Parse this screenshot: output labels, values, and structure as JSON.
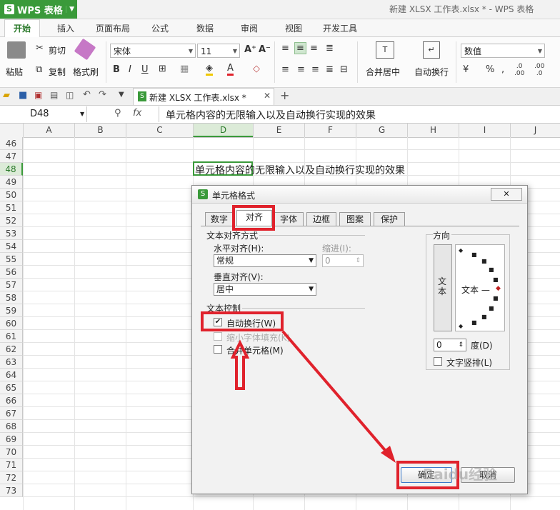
{
  "app": {
    "name": "WPS 表格",
    "window_title": "新建 XLSX 工作表.xlsx * - WPS 表格"
  },
  "menu_tabs": [
    "开始",
    "插入",
    "页面布局",
    "公式",
    "数据",
    "审阅",
    "视图",
    "开发工具"
  ],
  "ribbon": {
    "paste": "粘贴",
    "cut": "剪切",
    "copy": "复制",
    "format_painter": "格式刷",
    "font_name": "宋体",
    "font_size": "11",
    "merge_center": "合并居中",
    "wrap_text": "自动换行",
    "number_format": "数值",
    "percent": "%"
  },
  "doc_tab": {
    "label": "新建 XLSX 工作表.xlsx *"
  },
  "formula_bar": {
    "cell_ref": "D48",
    "fx": "fx",
    "content": "单元格内容的无限输入以及自动换行实现的效果"
  },
  "sheet": {
    "columns": [
      "A",
      "B",
      "C",
      "D",
      "E",
      "F",
      "G",
      "H",
      "I",
      "J"
    ],
    "rows": [
      "46",
      "47",
      "48",
      "49",
      "50",
      "51",
      "52",
      "53",
      "54",
      "55",
      "56",
      "57",
      "58",
      "59",
      "60",
      "61",
      "62",
      "63",
      "64",
      "65",
      "66",
      "67",
      "68",
      "69",
      "70",
      "71",
      "72",
      "73"
    ],
    "cell_d48": "单元格内容的无限输入以及自动换行实现的效果"
  },
  "dialog": {
    "title": "单元格格式",
    "tabs": [
      "数字",
      "对齐",
      "字体",
      "边框",
      "图案",
      "保护"
    ],
    "text_align_group": "文本对齐方式",
    "horizontal_label": "水平对齐(H):",
    "horizontal_value": "常规",
    "indent_label": "缩进(I):",
    "indent_value": "0",
    "vertical_label": "垂直对齐(V):",
    "vertical_value": "居中",
    "text_control_group": "文本控制",
    "wrap_text": "自动换行(W)",
    "shrink_to_fit": "缩小字体填充(K)",
    "merge_cells": "合并单元格(M)",
    "direction_group": "方向",
    "vertical_text": "文本",
    "orient_text": "文本 —",
    "degree_value": "0",
    "degree_label": "度(D)",
    "stacked_text": "文字竖排(L)",
    "ok": "确定",
    "cancel": "取消"
  },
  "colors": {
    "accent_green": "#3a9a3a",
    "annotation_red": "#e0222c"
  },
  "watermark": "Baidu经验"
}
